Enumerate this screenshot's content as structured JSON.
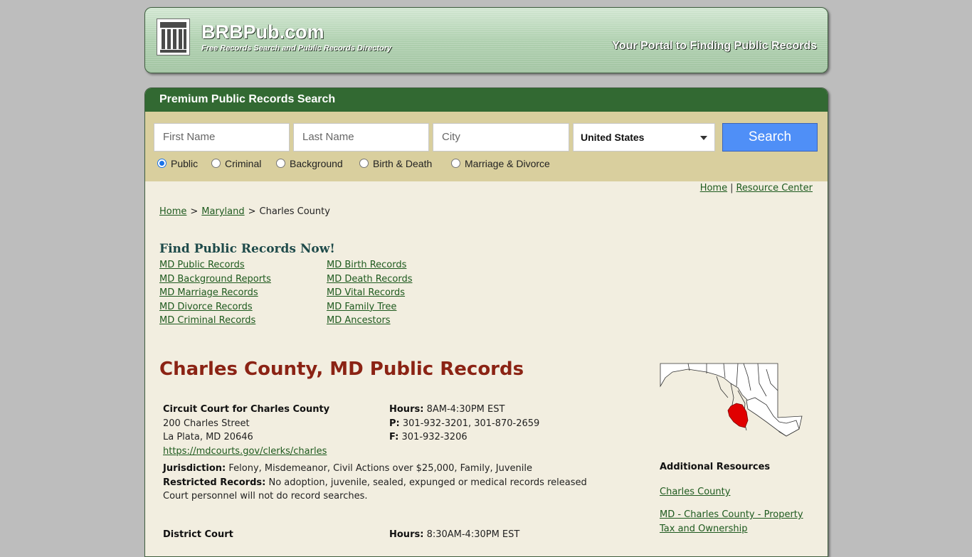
{
  "header": {
    "brand": "BRBPub.com",
    "tagline": "Free Records Search and Public Records Directory",
    "portal": "Your Portal to Finding Public Records"
  },
  "search": {
    "heading": "Premium Public Records Search",
    "first_name_placeholder": "First Name",
    "last_name_placeholder": "Last Name",
    "city_placeholder": "City",
    "country": "United States",
    "button": "Search",
    "types": [
      "Public",
      "Criminal",
      "Background",
      "Birth & Death",
      "Marriage & Divorce"
    ],
    "selected_type": "Public"
  },
  "toplinks": {
    "home": "Home",
    "sep": "|",
    "resource": "Resource Center"
  },
  "breadcrumb": {
    "home": "Home",
    "state": "Maryland",
    "current": "Charles County",
    "gt": ">"
  },
  "find": {
    "title": "Find Public Records Now!",
    "left": [
      "MD Public Records",
      "MD Background Reports",
      "MD Marriage Records",
      "MD Divorce Records",
      "MD Criminal Records"
    ],
    "right": [
      "MD Birth Records",
      "MD Death Records",
      "MD Vital Records",
      "MD Family Tree",
      "MD Ancestors"
    ]
  },
  "page_title": "Charles County, MD Public Records",
  "courts": [
    {
      "name": "Circuit Court for Charles County",
      "address1": "200 Charles Street",
      "address2": "La Plata, MD 20646",
      "url": "https://mdcourts.gov/clerks/charles",
      "hours_label": "Hours:",
      "hours": "8AM-4:30PM EST",
      "phone_label": "P:",
      "phone": "301-932-3201, 301-870-2659",
      "fax_label": "F:",
      "fax": "301-932-3206",
      "jurisdiction_label": "Jurisdiction:",
      "jurisdiction": "Felony, Misdemeanor, Civil Actions over $25,000, Family, Juvenile",
      "restricted_label": "Restricted Records:",
      "restricted": "No adoption, juvenile, sealed, expunged or medical records released",
      "note": "Court personnel will not do record searches."
    },
    {
      "name": "District Court",
      "hours_label": "Hours:",
      "hours": "8:30AM-4:30PM EST"
    }
  ],
  "additional": {
    "title": "Additional Resources",
    "links": [
      "Charles County",
      "MD - Charles County - Property Tax and Ownership"
    ]
  },
  "colors": {
    "header_green": "#326932",
    "panel_tan": "#d9cf9e",
    "page_bg": "#f2eee0",
    "title_red": "#8b2314",
    "link_green": "#1e5a1e",
    "search_blue": "#4f8ff7",
    "map_highlight": "#e00000"
  }
}
